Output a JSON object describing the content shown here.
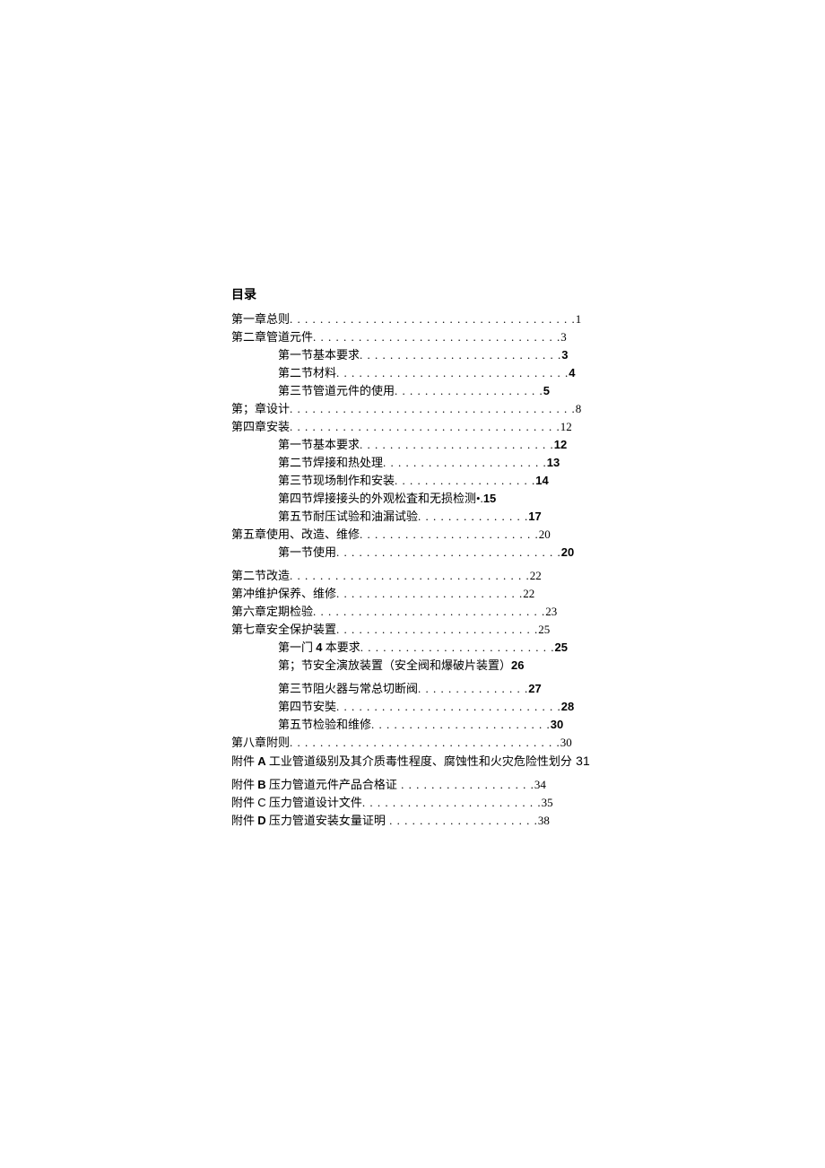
{
  "toc": {
    "title": "目录",
    "entries": [
      {
        "label": "第一章总则",
        "dots": ". . . . . . . . . . . . . . . . . . . . . . . . . . . . . . . . . . . . . .",
        "page": "1",
        "indent": false,
        "boldPage": false
      },
      {
        "label": "第二章管道元件",
        "dots": ". . . . . . . . . . . . . . . . . . . . . . . . . . . . . . . . .",
        "page": "3",
        "indent": false,
        "boldPage": false
      },
      {
        "label": "第一节基本要求",
        "dots": ". . . . . . . . . . . . . . . . . . . . . . . . . . .",
        "page": "3",
        "indent": true,
        "boldPage": true
      },
      {
        "label": "第二节材料",
        "dots": ". . . . . . . . . . . . . . . . . . . . . . . . . . . . . . .",
        "page": "4",
        "indent": true,
        "boldPage": true
      },
      {
        "label": "第三节管道元件的使用",
        "dots": ". . . . . . . . . . . . . . . . . . . .",
        "page": "5",
        "indent": true,
        "boldPage": true
      },
      {
        "label": "第；章设计",
        "dots": ". . . . . . . . . . . . . . . . . . . . . . . . . . . . . . . . . . . . . .",
        "page": "8",
        "indent": false,
        "boldPage": false
      },
      {
        "label": "第四章安装",
        "dots": ". . . . . . . . . . . . . . . . . . . . . . . . . . . . . . . . . . . .",
        "page": "12",
        "indent": false,
        "boldPage": false
      },
      {
        "label": "第一节基本要求",
        "dots": ". . . . . . . . . . . . . . . . . . . . . . . . . .",
        "page": "12",
        "indent": true,
        "boldPage": true
      },
      {
        "label": "第二节焊接和热处理",
        "dots": ". . . . . . . . . . . . . . . . . . . . . .",
        "page": "13",
        "indent": true,
        "boldPage": true
      },
      {
        "label": "第三节现场制作和安装",
        "dots": ". . . . . . . . . . . . . . . . . . .",
        "page": "14",
        "indent": true,
        "boldPage": true
      },
      {
        "label": "第四节焊接接头的外观松査和无损检测•.",
        "dots": "",
        "page": "15",
        "indent": true,
        "boldPage": true
      },
      {
        "label": "第五节耐压试验和油漏试验",
        "dots": ". . . . . . . . . . . . . . .",
        "page": "17",
        "indent": true,
        "boldPage": true
      },
      {
        "label": "第五章使用、改造、维修",
        "dots": ". . . . . . . . . . . . . . . . . . . . . . . .",
        "page": "20",
        "indent": false,
        "boldPage": false
      },
      {
        "label": "第一节使用",
        "dots": ". . . . . . . . . . . . . . . . . . . . . . . . . . . . . .",
        "page": "20",
        "indent": true,
        "boldPage": true
      },
      {
        "label": "第二节改造",
        "dots": ". . . . . . . . . . . . . . . . . . . . . . . . . . . . . . . .",
        "page": "22",
        "indent": false,
        "boldPage": false,
        "gap": true
      },
      {
        "label": "第冲维护保养、维修",
        "dots": ". . . . . . . . . . . . . . . . . . . . . . . . .",
        "page": "22",
        "indent": false,
        "boldPage": false
      },
      {
        "label": "第六章定期检验",
        "dots": ". . . . . . . . . . . . . . . . . . . . . . . . . . . . . . .",
        "page": "23",
        "indent": false,
        "boldPage": false
      },
      {
        "label": "第七章安全保护装置",
        "dots": ". . . . . . . . . . . . . . . . . . . . . . . . . . .",
        "page": "25",
        "indent": false,
        "boldPage": false
      },
      {
        "label": "第一门 <b>4</b> 本要求",
        "dots": ". . . . . . . . . . . . . . . . . . . . . . . . . .",
        "page": "25",
        "indent": true,
        "boldPage": true,
        "html": true
      },
      {
        "label": "第；节安全演放装置（安全阀和爆破片装置）",
        "dots": "",
        "page": "26",
        "indent": true,
        "boldPage": true
      },
      {
        "label": "第三节阻火器与常总切断阀",
        "dots": ". . . . . . . . . . . . . . .",
        "page": "27",
        "indent": true,
        "boldPage": true,
        "gap": true
      },
      {
        "label": "第四节安奘",
        "dots": ". . . . . . . . . . . . . . . . . . . . . . . . . . . . . .",
        "page": "28",
        "indent": true,
        "boldPage": true
      },
      {
        "label": "第五节检验和维修",
        "dots": ". . . . . . . . . . . . . . . . . . . . . . . .",
        "page": "30",
        "indent": true,
        "boldPage": true
      },
      {
        "label": "第八章附则",
        "dots": ". . . . . . . . . . . . . . . . . . . . . . . . . . . . . . . . . . . .",
        "page": "30",
        "indent": false,
        "boldPage": false
      },
      {
        "label": "附件 <b>A</b> 工业管道级别及其介质毒性程度、腐蚀性和火灾危险性划分",
        "dots": " ",
        "page": "31",
        "indent": false,
        "boldPage": false,
        "html": true,
        "pageFamily": "arial"
      },
      {
        "label": "附件 <b>B</b> 压力管道元件产品合格证",
        "dots": " . . . . . . . . . . . . . . . . . .",
        "page": "34",
        "indent": false,
        "boldPage": false,
        "gap": true,
        "html": true
      },
      {
        "label": "附件 <span class='plain-latin'>C</span> 压力管道设计文件",
        "dots": ". . . . . . . . . . . . . . . . . . . . . . . .",
        "page": "35",
        "indent": false,
        "boldPage": false,
        "html": true
      },
      {
        "label": "附件 <b>D</b> 压力管道安装女量证明",
        "dots": " . . . . . . . . . . . . . . . . . . . .",
        "page": "38",
        "indent": false,
        "boldPage": false,
        "html": true
      }
    ]
  }
}
